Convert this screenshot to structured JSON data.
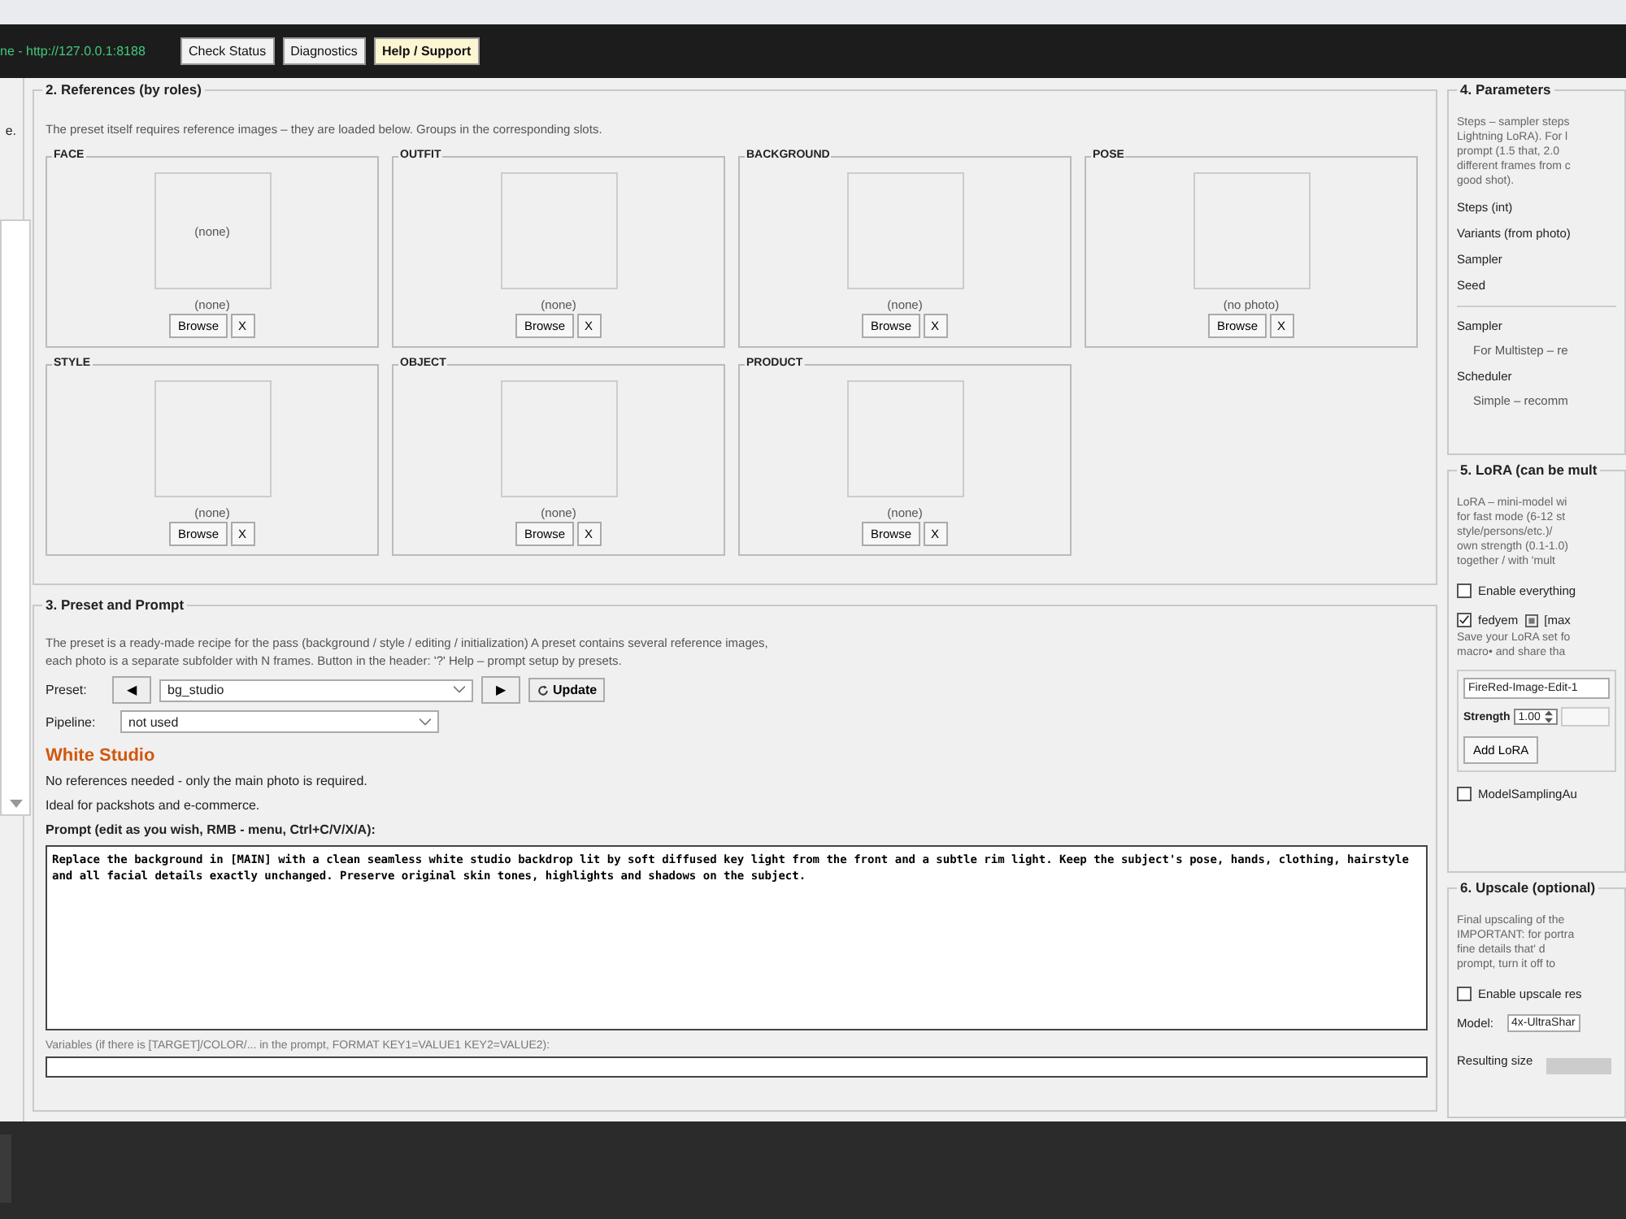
{
  "header": {
    "status": "ne - http://127.0.0.1:8188",
    "buttons": [
      {
        "label": "Check Status",
        "kind": "plain"
      },
      {
        "label": "Diagnostics",
        "kind": "plain"
      },
      {
        "label": "Help / Support",
        "kind": "highlight"
      }
    ]
  },
  "left_panel": {
    "text": "e."
  },
  "references": {
    "title": "2. References (by roles)",
    "hint": "The preset itself requires reference images – they are loaded below. Groups in the corresponding slots.",
    "slots": [
      {
        "role": "FACE",
        "preview_text": "(none)",
        "caption": "(none)",
        "browse": "Browse",
        "clear": "X"
      },
      {
        "role": "OUTFIT",
        "caption": "(none)",
        "browse": "Browse",
        "clear": "X"
      },
      {
        "role": "BACKGROUND",
        "caption": "(none)",
        "browse": "Browse",
        "clear": "X"
      },
      {
        "role": "POSE",
        "caption": "(no photo)",
        "browse": "Browse",
        "clear": "X"
      },
      {
        "role": "STYLE",
        "caption": "(none)",
        "browse": "Browse",
        "clear": "X"
      },
      {
        "role": "OBJECT",
        "caption": "(none)",
        "browse": "Browse",
        "clear": "X"
      },
      {
        "role": "PRODUCT",
        "caption": "(none)",
        "browse": "Browse",
        "clear": "X"
      }
    ]
  },
  "preset": {
    "title": "3. Preset and Prompt",
    "description": [
      "The preset is a ready-made recipe for the pass (background / style / editing / initialization) A preset contains several reference images,",
      "each photo is a separate subfolder with N frames. Button in the header: '?' Help – prompt setup by presets."
    ],
    "preset_label": "Preset:",
    "prev": "◀",
    "preset_value": "bg_studio",
    "next": "▶",
    "update": "Update",
    "pipeline_label": "Pipeline:",
    "pipeline_value": "not used",
    "name": "White Studio",
    "notes": [
      "No references needed - only the main photo is required.",
      "Ideal for packshots and e-commerce."
    ],
    "prompt_label": "Prompt (edit as you wish, RMB - menu, Ctrl+C/V/X/A):",
    "prompt": "Replace the background in [MAIN] with a clean seamless white studio backdrop lit by soft diffused key light from the front and a subtle rim light. Keep the subject's pose, hands, clothing, hairstyle and all facial details exactly unchanged. Preserve original skin tones, highlights and shadows on the subject.",
    "variables_label": "Variables (if there is [TARGET]/COLOR/... in the prompt, FORMAT KEY1=VALUE1 KEY2=VALUE2):"
  },
  "parameters": {
    "title": "4. Parameters",
    "description": [
      "Steps – sampler steps",
      "Lightning LoRA). For l",
      "prompt (1.5 that, 2.0",
      "different frames from c",
      "good shot)."
    ],
    "fields": [
      "Steps (int)",
      "Variants (from photo)",
      "Sampler",
      "Seed"
    ],
    "sampler_label": "Sampler",
    "sampler_note": "For Multistep – re",
    "scheduler_label": "Scheduler",
    "scheduler_note": "Simple – recomm"
  },
  "lora": {
    "title": "5. LoRA (can be mult",
    "description": [
      "LoRA – mini-model wi",
      "for fast mode (6-12 st",
      "style/persons/etc.)/",
      "own strength (0.1-1.0)",
      "together / with 'mult"
    ],
    "enable": {
      "label": "Enable everything",
      "checked": false
    },
    "preset_toggle": {
      "label": "fedyem",
      "checked": true,
      "extra": "[max"
    },
    "save_hint": [
      "Save your LoRA set fo",
      "macro• and share tha"
    ],
    "lora_name": "FireRed-Image-Edit-1",
    "strength_label": "Strength",
    "strength": "1.00",
    "add": "Add LoRA",
    "model_sampling": {
      "label": "ModelSamplingAu",
      "checked": false
    }
  },
  "upscale": {
    "title": "6. Upscale (optional)",
    "description": [
      "Final upscaling of the",
      "IMPORTANT: for portra",
      "fine details that' d",
      "prompt, turn it off to"
    ],
    "enable": {
      "label": "Enable upscale res",
      "checked": false
    },
    "model_label": "Model:",
    "model": "4x-UltraShar",
    "size_label": "Resulting size"
  }
}
